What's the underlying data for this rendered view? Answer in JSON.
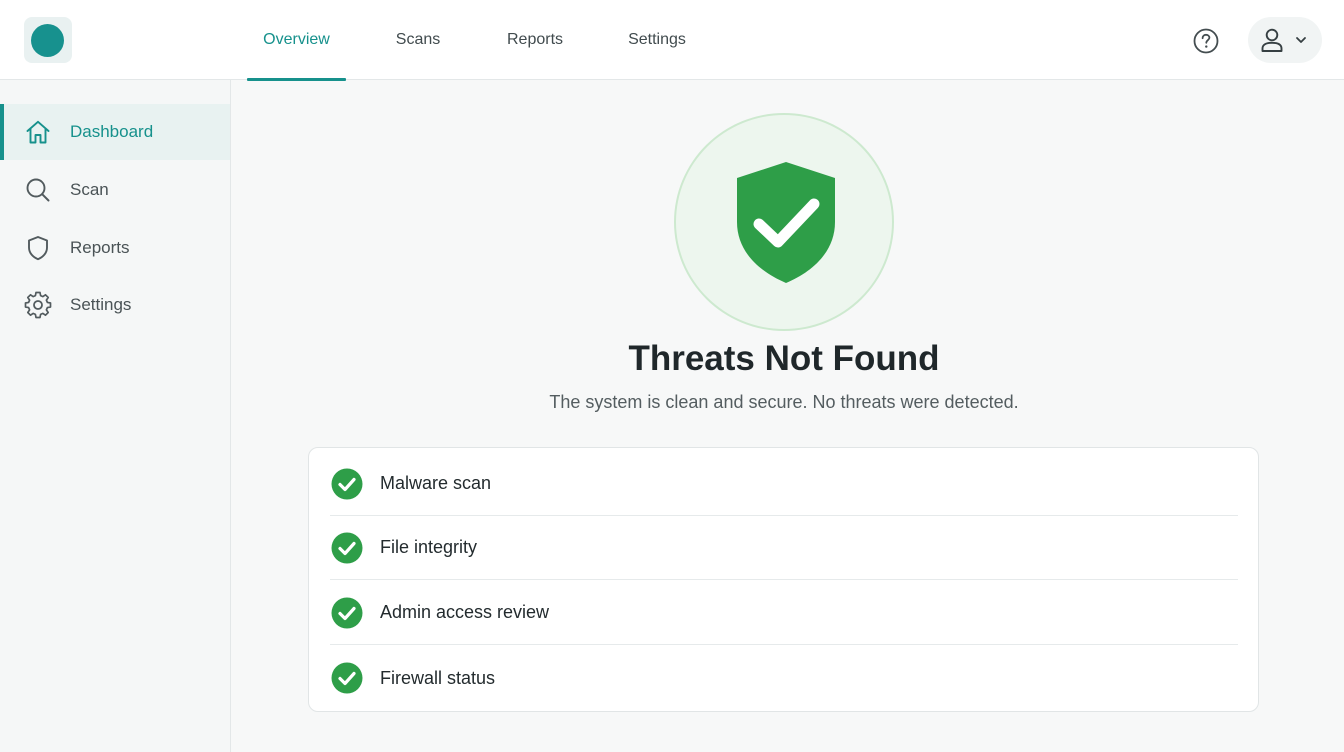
{
  "header": {
    "tabs": [
      {
        "label": "Overview",
        "active": true
      },
      {
        "label": "Scans",
        "active": false
      },
      {
        "label": "Reports",
        "active": false
      },
      {
        "label": "Settings",
        "active": false
      }
    ],
    "help_icon": "help-circle-icon",
    "user_icon": "user-icon",
    "user_menu_icon": "chevron-down-icon"
  },
  "sidebar": {
    "items": [
      {
        "label": "Dashboard",
        "icon": "home-icon",
        "active": true
      },
      {
        "label": "Scan",
        "icon": "search-icon",
        "active": false
      },
      {
        "label": "Reports",
        "icon": "shield-icon",
        "active": false
      },
      {
        "label": "Settings",
        "icon": "gear-icon",
        "active": false
      }
    ]
  },
  "main": {
    "status_icon": "shield-check-icon",
    "title": "Threats Not Found",
    "subtitle": "The system is clean and secure. No threats were detected.",
    "checks": [
      {
        "label": "Malware scan",
        "status": "passed"
      },
      {
        "label": "File integrity",
        "status": "passed"
      },
      {
        "label": "Admin access review",
        "status": "passed"
      },
      {
        "label": "Firewall status",
        "status": "passed"
      }
    ]
  },
  "colors": {
    "accent": "#16918c",
    "success": "#2e9e48",
    "success_bg": "#edf6ee"
  }
}
